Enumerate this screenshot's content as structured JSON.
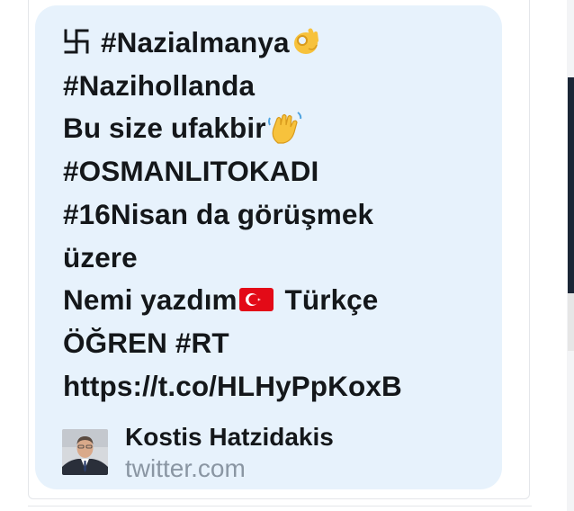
{
  "tweet": {
    "lines": [
      {
        "symbol": "swastika-icon",
        "text": "#Nazialmanya",
        "emoji": "ok-hand-emoji"
      },
      {
        "text": "#Nazihollanda"
      },
      {
        "text": "Bu size ufakbir",
        "emoji": "waving-hand-emoji"
      },
      {
        "text": "#OSMANLITOKADI"
      },
      {
        "text": "#16Nisan da görüşmek"
      },
      {
        "text": "üzere"
      },
      {
        "text_before": "Nemi yazdım",
        "emoji": "turkey-flag-emoji",
        "text_after": " Türkçe"
      },
      {
        "text": "ÖĞREN #RT"
      },
      {
        "text": "https://t.co/HLHyPpKoxB"
      }
    ]
  },
  "preview": {
    "title": "Kostis Hatzidakis",
    "domain": "twitter.com",
    "avatar_icon": "person-avatar"
  },
  "colors": {
    "bubble": "#e7f2fc",
    "text": "#14171a",
    "domain": "#8a96a3",
    "flag_red": "#e30a17"
  }
}
